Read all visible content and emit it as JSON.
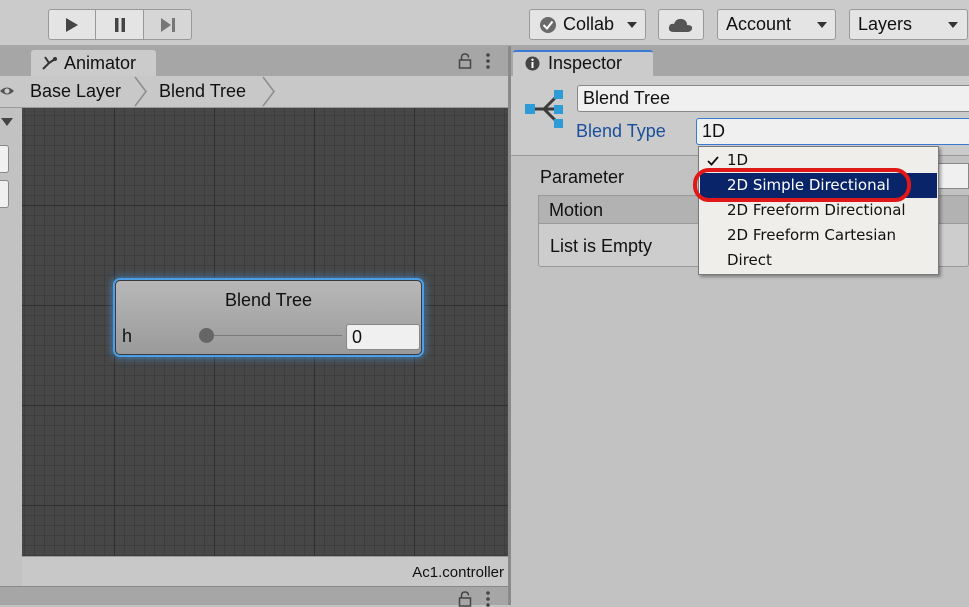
{
  "toolbar": {
    "collab_label": "Collab",
    "account_label": "Account",
    "layers_label": "Layers"
  },
  "animator": {
    "tab_label": "Animator",
    "breadcrumbs": [
      "Base Layer",
      "Blend Tree"
    ],
    "node": {
      "title": "Blend Tree",
      "param_name": "h",
      "param_value": "0"
    },
    "footer_file": "Ac1.controller"
  },
  "inspector": {
    "tab_label": "Inspector",
    "name_value": "Blend Tree",
    "blend_type_label": "Blend Type",
    "blend_type_value": "1D",
    "parameter_label": "Parameter",
    "motion_label": "Motion",
    "list_empty": "List is Empty"
  },
  "dropdown": {
    "options": [
      "1D",
      "2D Simple Directional",
      "2D Freeform Directional",
      "2D Freeform Cartesian",
      "Direct"
    ],
    "checked": "1D",
    "highlighted": "2D Simple Directional"
  },
  "colors": {
    "highlight_bg": "#0a246a",
    "annotation_ring": "#e01818",
    "link_label": "#1a4f9c",
    "node_glow": "#4a9fe8"
  }
}
